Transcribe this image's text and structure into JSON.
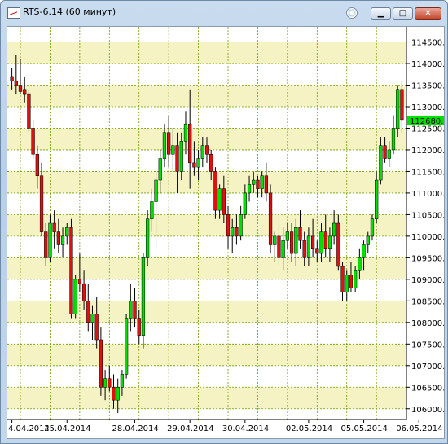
{
  "window": {
    "title": "RTS-6.14 (60 минут)",
    "buttons": {
      "minimize": "▁",
      "maximize": "□",
      "close": "✕"
    }
  },
  "colors": {
    "bull": "#00e000",
    "bear": "#e01010",
    "band_a": "#f5f2c4",
    "band_b": "#ffffff",
    "grid": "#6aa000",
    "price_tag": "#00e000"
  },
  "chart_data": {
    "type": "candlestick",
    "symbol": "RTS-6.14",
    "timeframe": "60 минут",
    "grid": true,
    "ylim": [
      105750,
      114850
    ],
    "y_ticks": [
      "106000.",
      "106500.",
      "107000.",
      "107500.",
      "108000.",
      "108500.",
      "109000.",
      "109500.",
      "110000.",
      "110500.",
      "111000.",
      "111500.",
      "112000.",
      "112500.",
      "113000.",
      "113500.",
      "114000.",
      "114500."
    ],
    "last_price": "112680.",
    "x_date_labels": [
      "4.04.2014",
      "25.04.2014",
      "28.04.2014",
      "29.04.2014",
      "30.04.2014",
      "02.05.2014",
      "05.05.2014",
      "06.05.2014"
    ],
    "x_date_label_bars": [
      0,
      13,
      29,
      42,
      55,
      70,
      83,
      96
    ],
    "candles": [
      [
        113700,
        113900,
        113400,
        113600
      ],
      [
        113600,
        114200,
        113300,
        113500
      ],
      [
        113500,
        114100,
        113300,
        113350
      ],
      [
        113400,
        113700,
        113100,
        113300
      ],
      [
        113300,
        113400,
        112400,
        112500
      ],
      [
        112500,
        112700,
        111800,
        111900
      ],
      [
        111900,
        112100,
        111100,
        111400
      ],
      [
        111400,
        111700,
        110000,
        110100
      ],
      [
        110100,
        110300,
        109300,
        109500
      ],
      [
        109500,
        110500,
        109400,
        110300
      ],
      [
        110300,
        110600,
        109700,
        110100
      ],
      [
        110100,
        110400,
        109600,
        109800
      ],
      [
        109800,
        110200,
        109500,
        110000
      ],
      [
        110000,
        110300,
        109800,
        110200
      ],
      [
        110200,
        110400,
        108100,
        108200
      ],
      [
        108200,
        109100,
        108100,
        109000
      ],
      [
        109000,
        109600,
        108700,
        108900
      ],
      [
        108900,
        109200,
        108300,
        108500
      ],
      [
        108500,
        108900,
        107800,
        108000
      ],
      [
        108000,
        108400,
        107600,
        108200
      ],
      [
        108200,
        108600,
        107400,
        107600
      ],
      [
        107600,
        107900,
        106300,
        106500
      ],
      [
        106500,
        106900,
        106200,
        106700
      ],
      [
        106700,
        107000,
        106400,
        106500
      ],
      [
        106500,
        106800,
        106000,
        106200
      ],
      [
        106200,
        106700,
        105900,
        106500
      ],
      [
        106500,
        106900,
        106300,
        106800
      ],
      [
        106800,
        108200,
        106700,
        108100
      ],
      [
        108100,
        108900,
        107800,
        108500
      ],
      [
        108500,
        108800,
        107900,
        108100
      ],
      [
        108100,
        108300,
        107500,
        107700
      ],
      [
        107700,
        109600,
        107400,
        109500
      ],
      [
        109500,
        110600,
        109300,
        110400
      ],
      [
        110400,
        111100,
        110100,
        110800
      ],
      [
        110800,
        111500,
        109700,
        111300
      ],
      [
        111300,
        112000,
        111000,
        111800
      ],
      [
        111800,
        112600,
        111600,
        112400
      ],
      [
        112400,
        112800,
        111600,
        111900
      ],
      [
        111900,
        112500,
        111500,
        112100
      ],
      [
        112100,
        112400,
        111000,
        111500
      ],
      [
        111500,
        112400,
        111300,
        112200
      ],
      [
        112200,
        112900,
        111900,
        112600
      ],
      [
        112600,
        113400,
        111100,
        111700
      ],
      [
        111700,
        112200,
        111400,
        111600
      ],
      [
        111600,
        112000,
        111300,
        111800
      ],
      [
        111800,
        112300,
        111600,
        112100
      ],
      [
        112100,
        112300,
        111700,
        111900
      ],
      [
        111900,
        112000,
        111300,
        111500
      ],
      [
        111500,
        111600,
        110400,
        110600
      ],
      [
        110600,
        111200,
        110400,
        111100
      ],
      [
        111100,
        111400,
        110300,
        110500
      ],
      [
        110500,
        110700,
        109700,
        110000
      ],
      [
        110000,
        110400,
        109600,
        110200
      ],
      [
        110200,
        110500,
        109800,
        110000
      ],
      [
        110000,
        110700,
        109900,
        110500
      ],
      [
        110500,
        111200,
        110400,
        111000
      ],
      [
        111000,
        111400,
        110800,
        111200
      ],
      [
        111200,
        111500,
        111000,
        111300
      ],
      [
        111300,
        111400,
        110900,
        111100
      ],
      [
        111100,
        111500,
        110900,
        111400
      ],
      [
        111400,
        111700,
        110800,
        111000
      ],
      [
        111000,
        111200,
        109600,
        109800
      ],
      [
        109800,
        110100,
        109400,
        110000
      ],
      [
        110000,
        110300,
        109300,
        109500
      ],
      [
        109500,
        110200,
        109200,
        109900
      ],
      [
        109900,
        110300,
        109700,
        110100
      ],
      [
        110100,
        110300,
        109400,
        109600
      ],
      [
        109600,
        110400,
        109300,
        110200
      ],
      [
        110200,
        110600,
        109700,
        109900
      ],
      [
        109900,
        110100,
        109300,
        109500
      ],
      [
        109500,
        110200,
        109300,
        110000
      ],
      [
        110000,
        110400,
        109500,
        109700
      ],
      [
        109700,
        109900,
        109400,
        109600
      ],
      [
        109600,
        110300,
        109400,
        110100
      ],
      [
        110100,
        110500,
        109500,
        109700
      ],
      [
        109700,
        110200,
        109400,
        110000
      ],
      [
        110000,
        110600,
        109800,
        110300
      ],
      [
        110300,
        110500,
        109200,
        109300
      ],
      [
        109300,
        109400,
        108500,
        108700
      ],
      [
        108700,
        109200,
        108500,
        109100
      ],
      [
        109100,
        109400,
        108700,
        108800
      ],
      [
        108800,
        109300,
        108700,
        109200
      ],
      [
        109200,
        109700,
        109000,
        109500
      ],
      [
        109500,
        109900,
        109200,
        109800
      ],
      [
        109800,
        110100,
        109600,
        110000
      ],
      [
        110000,
        110500,
        109900,
        110400
      ],
      [
        110400,
        111500,
        110300,
        111300
      ],
      [
        111300,
        112300,
        111200,
        112100
      ],
      [
        112100,
        112300,
        111700,
        111800
      ],
      [
        111800,
        112200,
        111600,
        112000
      ],
      [
        112000,
        112800,
        111900,
        112500
      ],
      [
        112500,
        113500,
        112300,
        113400
      ],
      [
        113400,
        113600,
        112400,
        112700
      ]
    ]
  }
}
